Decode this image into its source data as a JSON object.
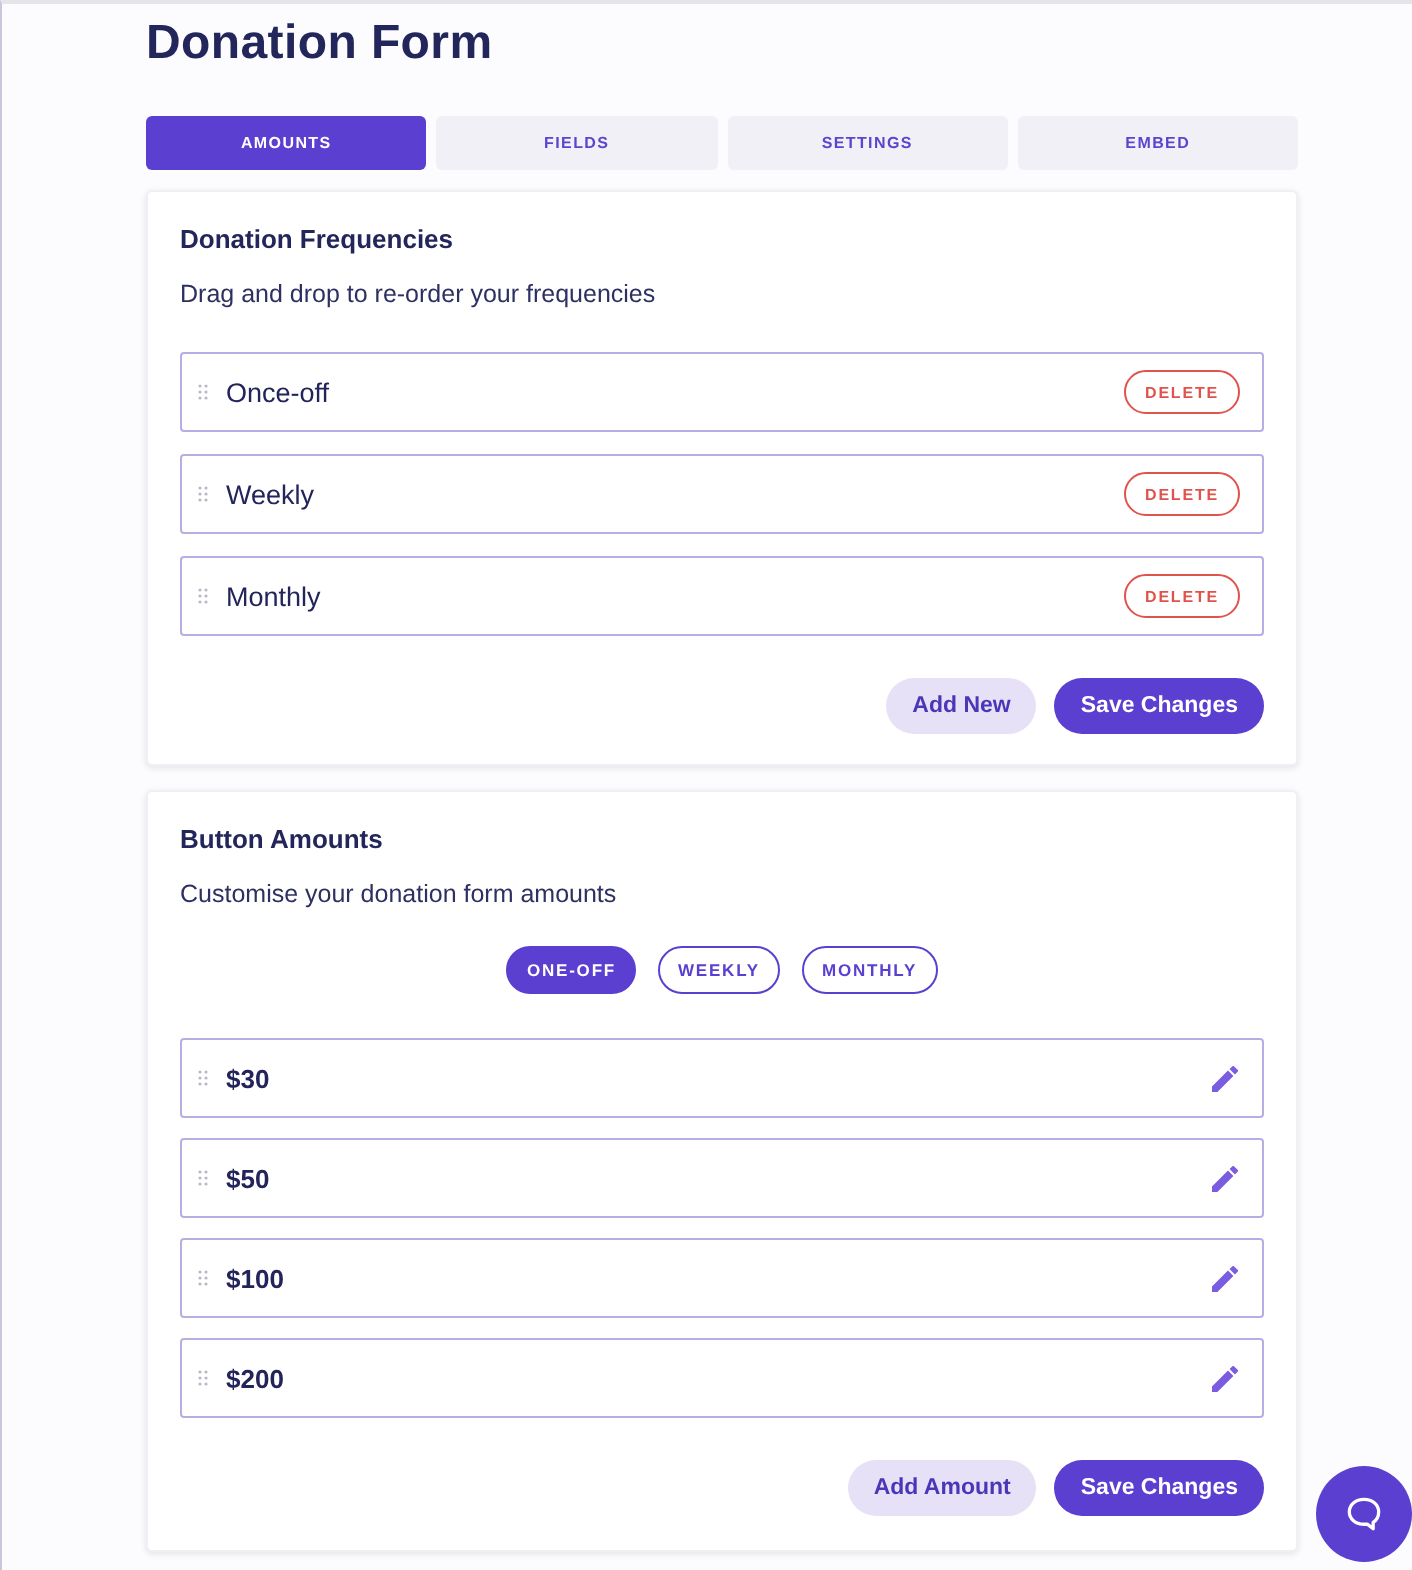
{
  "page": {
    "title": "Donation Form"
  },
  "tabs": [
    {
      "label": "AMOUNTS",
      "selected": true
    },
    {
      "label": "FIELDS",
      "selected": false
    },
    {
      "label": "SETTINGS",
      "selected": false
    },
    {
      "label": "EMBED",
      "selected": false
    }
  ],
  "frequencies": {
    "title": "Donation Frequencies",
    "subtitle": "Drag and drop to re-order your frequencies",
    "items": [
      {
        "label": "Once-off",
        "action": "DELETE"
      },
      {
        "label": "Weekly",
        "action": "DELETE"
      },
      {
        "label": "Monthly",
        "action": "DELETE"
      }
    ],
    "buttons": [
      {
        "label": "Add New",
        "kind": "secondary"
      },
      {
        "label": "Save Changes",
        "kind": "primary"
      }
    ]
  },
  "amounts": {
    "title": "Button Amounts",
    "subtitle": "Customise your donation form amounts",
    "filters": [
      {
        "label": "ONE-OFF",
        "selected": true
      },
      {
        "label": "WEEKLY",
        "selected": false
      },
      {
        "label": "MONTHLY",
        "selected": false
      }
    ],
    "items": [
      "$30",
      "$50",
      "$100",
      "$200"
    ],
    "buttons": [
      {
        "label": "Add Amount",
        "kind": "secondary"
      },
      {
        "label": "Save Changes",
        "kind": "primary"
      }
    ]
  }
}
